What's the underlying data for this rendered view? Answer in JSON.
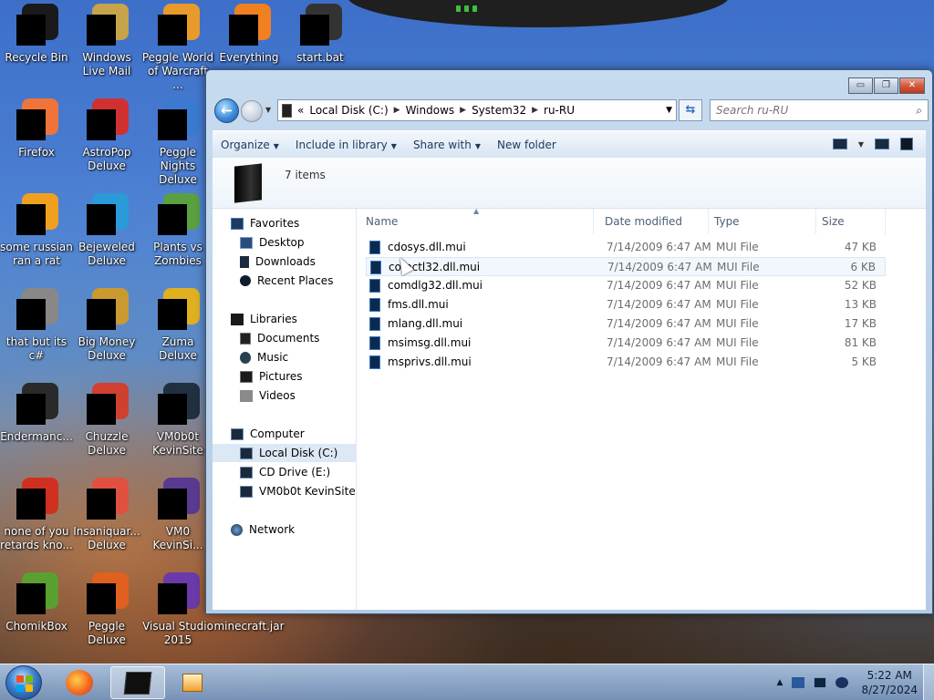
{
  "desktop": {
    "icons": [
      {
        "label": "Recycle Bin",
        "color": "#1a1a1a"
      },
      {
        "label": "Windows Live Mail",
        "color": "#c6a44a"
      },
      {
        "label": "Peggle World of Warcraft ...",
        "color": "#e89a2b"
      },
      {
        "label": "Everything",
        "color": "#f08020"
      },
      {
        "label": "start.bat",
        "color": "#333333"
      },
      {
        "label": "Firefox",
        "color": "#f0743a"
      },
      {
        "label": "AstroPop Deluxe",
        "color": "#d03030"
      },
      {
        "label": "Peggle Nights Deluxe",
        "color": "#3a7ad0"
      },
      {
        "label": "some russian ran a rat",
        "color": "#f0a020"
      },
      {
        "label": "Bejeweled Deluxe",
        "color": "#2a9ad8"
      },
      {
        "label": "Plants vs Zombies",
        "color": "#5aa040"
      },
      {
        "label": "that but its c#",
        "color": "#888888"
      },
      {
        "label": "Big Money Deluxe",
        "color": "#c89a30"
      },
      {
        "label": "Zuma Deluxe",
        "color": "#e0b020"
      },
      {
        "label": "Endermanc...",
        "color": "#2a2a2a"
      },
      {
        "label": "Chuzzle Deluxe",
        "color": "#d04030"
      },
      {
        "label": "VM0b0t KevinSite",
        "color": "#203040"
      },
      {
        "label": "none of you retards kno...",
        "color": "#d03020"
      },
      {
        "label": "Insaniquar... Deluxe",
        "color": "#e05040"
      },
      {
        "label": "VM0 KevinSi...",
        "color": "#5a3a90"
      },
      {
        "label": "ChomikBox",
        "color": "#5aa030"
      },
      {
        "label": "Peggle Deluxe",
        "color": "#e06020"
      },
      {
        "label": "Visual Studio 2015",
        "color": "#6a3aa8"
      },
      {
        "label": "minecraft.jar",
        "color": "#7a5a30"
      }
    ]
  },
  "explorer": {
    "address": {
      "prefix": "«",
      "crumbs": [
        "Local Disk (C:)",
        "Windows",
        "System32",
        "ru-RU"
      ]
    },
    "search": {
      "placeholder": "Search ru-RU"
    },
    "controls": {
      "minimize": "▭",
      "maximize": "❐",
      "close": "✕"
    },
    "toolbar": {
      "organize": "Organize",
      "include_in_library": "Include in library",
      "share_with": "Share with",
      "new_folder": "New folder"
    },
    "details": {
      "item_count": "7 items"
    },
    "navpane": {
      "favorites": "Favorites",
      "desktop": "Desktop",
      "downloads": "Downloads",
      "recent_places": "Recent Places",
      "libraries": "Libraries",
      "documents": "Documents",
      "music": "Music",
      "pictures": "Pictures",
      "videos": "Videos",
      "computer": "Computer",
      "local_disk": "Local Disk (C:)",
      "cd_drive": "CD Drive (E:)",
      "vm_site": "VM0b0t KevinSite",
      "network": "Network"
    },
    "columns": {
      "name": "Name",
      "date_modified": "Date modified",
      "type": "Type",
      "size": "Size"
    },
    "files": [
      {
        "name": "cdosys.dll.mui",
        "date": "7/14/2009 6:47 AM",
        "type": "MUI File",
        "size": "47 KB"
      },
      {
        "name": "comctl32.dll.mui",
        "date": "7/14/2009 6:47 AM",
        "type": "MUI File",
        "size": "6 KB"
      },
      {
        "name": "comdlg32.dll.mui",
        "date": "7/14/2009 6:47 AM",
        "type": "MUI File",
        "size": "52 KB"
      },
      {
        "name": "fms.dll.mui",
        "date": "7/14/2009 6:47 AM",
        "type": "MUI File",
        "size": "13 KB"
      },
      {
        "name": "mlang.dll.mui",
        "date": "7/14/2009 6:47 AM",
        "type": "MUI File",
        "size": "17 KB"
      },
      {
        "name": "msimsg.dll.mui",
        "date": "7/14/2009 6:47 AM",
        "type": "MUI File",
        "size": "81 KB"
      },
      {
        "name": "msprivs.dll.mui",
        "date": "7/14/2009 6:47 AM",
        "type": "MUI File",
        "size": "5 KB"
      }
    ]
  },
  "taskbar": {
    "clock_time": "5:22 AM",
    "clock_date": "8/27/2024",
    "tray_expand": "▲"
  }
}
